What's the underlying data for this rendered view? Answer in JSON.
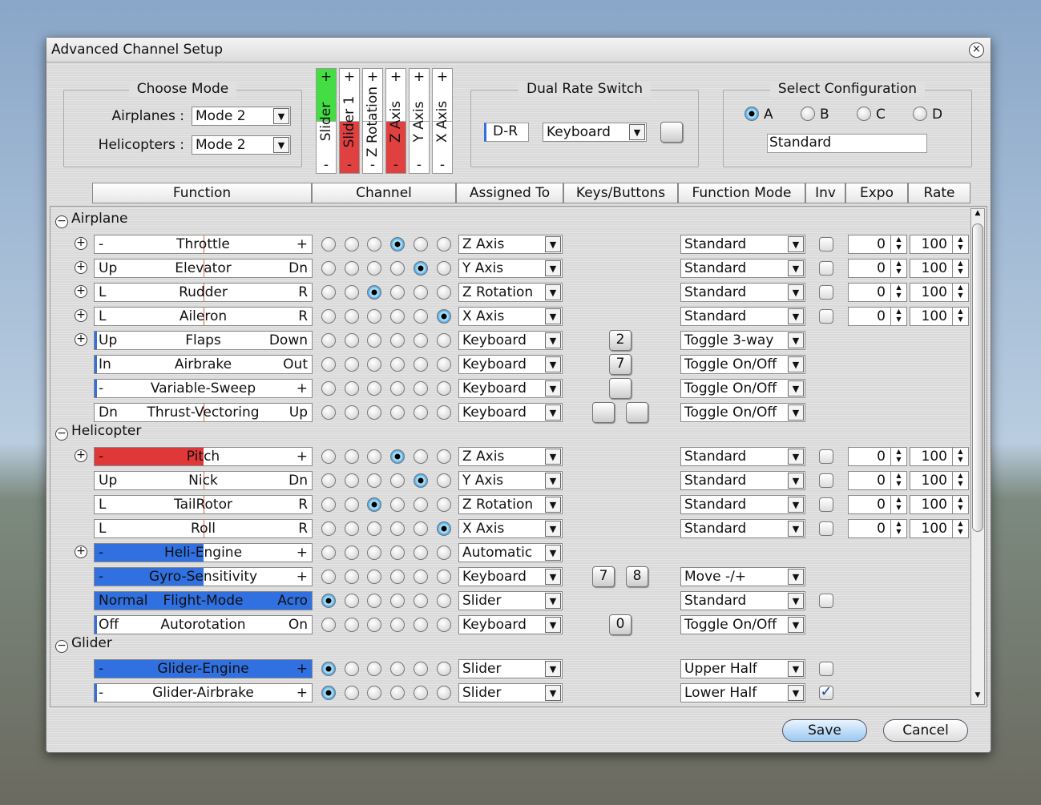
{
  "title": "Advanced Channel Setup",
  "choose_mode": {
    "legend": "Choose Mode",
    "airplanes_label": "Airplanes :",
    "airplanes_value": "Mode 2",
    "helicopters_label": "Helicopters :",
    "helicopters_value": "Mode 2"
  },
  "channels": [
    {
      "label": "Slider",
      "value": 1,
      "color": "#44dd44"
    },
    {
      "label": "Slider 1",
      "value": -1,
      "color": "#e04040"
    },
    {
      "label": "Z Rotation",
      "value": 0,
      "color": "#e04040"
    },
    {
      "label": "Z Axis",
      "value": -1,
      "color": "#e04040"
    },
    {
      "label": "Y Axis",
      "value": 0,
      "color": "#e04040"
    },
    {
      "label": "X Axis",
      "value": 0,
      "color": "#e04040"
    }
  ],
  "dual_rate": {
    "legend": "Dual Rate Switch",
    "label": "D-R",
    "source": "Keyboard"
  },
  "config": {
    "legend": "Select Configuration",
    "options": [
      "A",
      "B",
      "C",
      "D"
    ],
    "selected": "A",
    "name": "Standard"
  },
  "headers": [
    "Function",
    "Channel",
    "Assigned To",
    "Keys/Buttons",
    "Function Mode",
    "Inv",
    "Expo",
    "Rate"
  ],
  "sections": [
    {
      "name": "Airplane",
      "rows": [
        {
          "expand": true,
          "min": "-",
          "name": "Throttle",
          "max": "+",
          "fill": 0,
          "fill_color": "#3070e0",
          "channel": 3,
          "assigned": "Z Axis",
          "keys": [],
          "mode": "Standard",
          "inv": false,
          "expo": "0",
          "rate": "100"
        },
        {
          "expand": true,
          "min": "Up",
          "name": "Elevator",
          "max": "Dn",
          "fill": 0,
          "fill_color": "#3070e0",
          "channel": 4,
          "assigned": "Y Axis",
          "keys": [],
          "mode": "Standard",
          "inv": false,
          "expo": "0",
          "rate": "100"
        },
        {
          "expand": true,
          "min": "L",
          "name": "Rudder",
          "max": "R",
          "fill": 0,
          "fill_color": "#3070e0",
          "channel": 2,
          "assigned": "Z Rotation",
          "keys": [],
          "mode": "Standard",
          "inv": false,
          "expo": "0",
          "rate": "100"
        },
        {
          "expand": true,
          "min": "L",
          "name": "Aileron",
          "max": "R",
          "fill": 0,
          "fill_color": "#3070e0",
          "channel": 5,
          "assigned": "X Axis",
          "keys": [],
          "mode": "Standard",
          "inv": false,
          "expo": "0",
          "rate": "100"
        },
        {
          "expand": true,
          "min": "Up",
          "name": "Flaps",
          "max": "Down",
          "fill": 0.01,
          "fill_color": "#3070e0",
          "channel": -1,
          "assigned": "Keyboard",
          "keys": [
            "2"
          ],
          "mode": "Toggle 3-way"
        },
        {
          "expand": false,
          "min": "In",
          "name": "Airbrake",
          "max": "Out",
          "fill": 0.01,
          "fill_color": "#3070e0",
          "channel": -1,
          "assigned": "Keyboard",
          "keys": [
            "7"
          ],
          "mode": "Toggle On/Off"
        },
        {
          "expand": false,
          "min": "-",
          "name": "Variable-Sweep",
          "max": "+",
          "fill": 0.01,
          "fill_color": "#3070e0",
          "channel": -1,
          "assigned": "Keyboard",
          "keys": [
            ""
          ],
          "mode": "Toggle On/Off"
        },
        {
          "expand": false,
          "min": "Dn",
          "name": "Thrust-Vectoring",
          "max": "Up",
          "fill": 0,
          "fill_color": "#3070e0",
          "channel": -1,
          "assigned": "Keyboard",
          "keys": [
            "",
            ""
          ],
          "mode": "Toggle On/Off"
        }
      ]
    },
    {
      "name": "Helicopter",
      "rows": [
        {
          "expand": true,
          "min": "-",
          "name": "Pitch",
          "max": "+",
          "fill": 0.5,
          "fill_color": "#e03838",
          "channel": 3,
          "assigned": "Z Axis",
          "keys": [],
          "mode": "Standard",
          "inv": false,
          "expo": "0",
          "rate": "100"
        },
        {
          "expand": false,
          "min": "Up",
          "name": "Nick",
          "max": "Dn",
          "fill": 0,
          "fill_color": "#3070e0",
          "channel": 4,
          "assigned": "Y Axis",
          "keys": [],
          "mode": "Standard",
          "inv": false,
          "expo": "0",
          "rate": "100"
        },
        {
          "expand": false,
          "min": "L",
          "name": "TailRotor",
          "max": "R",
          "fill": 0,
          "fill_color": "#3070e0",
          "channel": 2,
          "assigned": "Z Rotation",
          "keys": [],
          "mode": "Standard",
          "inv": false,
          "expo": "0",
          "rate": "100"
        },
        {
          "expand": false,
          "min": "L",
          "name": "Roll",
          "max": "R",
          "fill": 0,
          "fill_color": "#3070e0",
          "channel": 5,
          "assigned": "X Axis",
          "keys": [],
          "mode": "Standard",
          "inv": false,
          "expo": "0",
          "rate": "100"
        },
        {
          "expand": true,
          "min": "-",
          "name": "Heli-Engine",
          "max": "+",
          "fill": 0.5,
          "fill_color": "#3070e0",
          "channel": -1,
          "assigned": "Automatic",
          "keys": []
        },
        {
          "expand": false,
          "min": "-",
          "name": "Gyro-Sensitivity",
          "max": "+",
          "fill": 0.5,
          "fill_color": "#3070e0",
          "channel": -1,
          "assigned": "Keyboard",
          "keys": [
            "7",
            "8"
          ],
          "mode": "Move -/+"
        },
        {
          "expand": false,
          "min": "Normal",
          "name": "Flight-Mode",
          "max": "Acro",
          "fill": 1,
          "fill_color": "#3070e0",
          "channel": 0,
          "assigned": "Slider",
          "keys": [],
          "mode": "Standard",
          "inv": false
        },
        {
          "expand": false,
          "min": "Off",
          "name": "Autorotation",
          "max": "On",
          "fill": 0.01,
          "fill_color": "#3070e0",
          "channel": -1,
          "assigned": "Keyboard",
          "keys": [
            "0"
          ],
          "mode": "Toggle On/Off"
        }
      ]
    },
    {
      "name": "Glider",
      "rows": [
        {
          "expand": false,
          "min": "-",
          "name": "Glider-Engine",
          "max": "+",
          "fill": 1,
          "fill_color": "#3070e0",
          "channel": 0,
          "assigned": "Slider",
          "keys": [],
          "mode": "Upper Half",
          "inv": false
        },
        {
          "expand": false,
          "min": "-",
          "name": "Glider-Airbrake",
          "max": "+",
          "fill": 0.01,
          "fill_color": "#3070e0",
          "channel": 0,
          "assigned": "Slider",
          "keys": [],
          "mode": "Lower Half",
          "inv": true
        }
      ]
    }
  ],
  "save_label": "Save",
  "cancel_label": "Cancel"
}
